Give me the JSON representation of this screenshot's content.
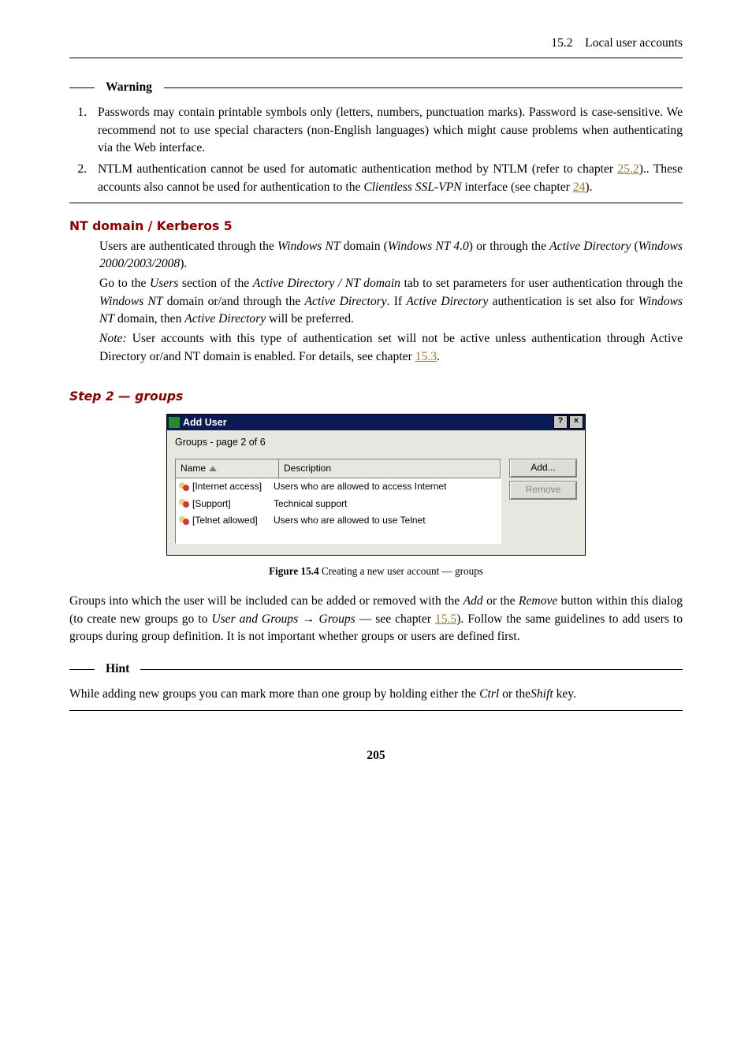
{
  "header": {
    "running": "15.2 Local user accounts"
  },
  "warning": {
    "legend": "Warning",
    "items": [
      "Passwords may contain printable symbols only (letters, numbers, punctuation marks).  Password is case-sensitive.  We recommend not to use special characters (non-English languages) which might cause problems when authenticating via the Web interface.",
      "NTLM authentication cannot be used for automatic authentication method by NTLM (refer to chapter ",
      ").. These accounts also cannot be used for authentication to the ",
      " interface (see chapter ",
      ")."
    ],
    "item2_link1": "25.2",
    "item2_em": "Clientless SSL-VPN",
    "item2_link2": "24"
  },
  "def": {
    "head": "NT domain / Kerberos 5",
    "p1a": "Users are authenticated through the ",
    "p1e1": "Windows NT",
    "p1b": " domain (",
    "p1e2": "Windows NT 4.0",
    "p1c": ") or through the ",
    "p1e3": "Active Directory",
    "p1d": " (",
    "p1e4": "Windows 2000/2003/2008",
    "p1e": ").",
    "p2a": "Go to the ",
    "p2e1": "Users",
    "p2b": " section of the ",
    "p2e2": "Active Directory / NT domain",
    "p2c": " tab to set parameters for user authentication through the ",
    "p2e3": "Windows NT",
    "p2d": " domain or/and through the ",
    "p2e4": "Active Directory",
    "p2e": ".  If ",
    "p2e5": "Active Directory",
    "p2f": " authentication is set also for ",
    "p2e6": "Windows NT",
    "p2g": " domain, then ",
    "p2e7": "Active Directory",
    "p2h": " will be preferred.",
    "p3e1": "Note:",
    "p3a": " User accounts with this type of authentication set will not be active unless authentication through Active Directory or/and NT domain is enabled.  For details, see chapter ",
    "p3link": "15.3",
    "p3b": "."
  },
  "step": {
    "head": "Step 2 — groups"
  },
  "dialog": {
    "title": "Add User",
    "help": "?",
    "close": "×",
    "page": "Groups - page 2 of 6",
    "cols": {
      "name": "Name",
      "desc": "Description"
    },
    "rows": [
      {
        "name": "[Internet access]",
        "desc": "Users who are allowed to access Internet"
      },
      {
        "name": "[Support]",
        "desc": "Technical support"
      },
      {
        "name": "[Telnet allowed]",
        "desc": "Users who are allowed to use Telnet"
      }
    ],
    "buttons": {
      "add": "Add...",
      "remove": "Remove"
    }
  },
  "figcap": {
    "num": "Figure 15.4",
    "txt": "   Creating a new user account — groups"
  },
  "para": {
    "a": "Groups into which the user will be included can be added or removed with the ",
    "e1": "Add",
    "b": " or the ",
    "e2": "Remove",
    "c": " button within this dialog (to create new groups go to ",
    "e3": "User and Groups",
    "arrow": " → ",
    "e4": "Groups",
    "d": " — see chapter ",
    "link": "15.5",
    "e": "). Follow the same guidelines to add users to groups during group definition. It is not important whether groups or users are defined first."
  },
  "hint": {
    "legend": "Hint",
    "a": "While adding new groups you can mark more than one group by holding either the ",
    "e1": "Ctrl",
    "b": " or the",
    "e2": "Shift",
    "c": " key."
  },
  "pagenum": "205"
}
